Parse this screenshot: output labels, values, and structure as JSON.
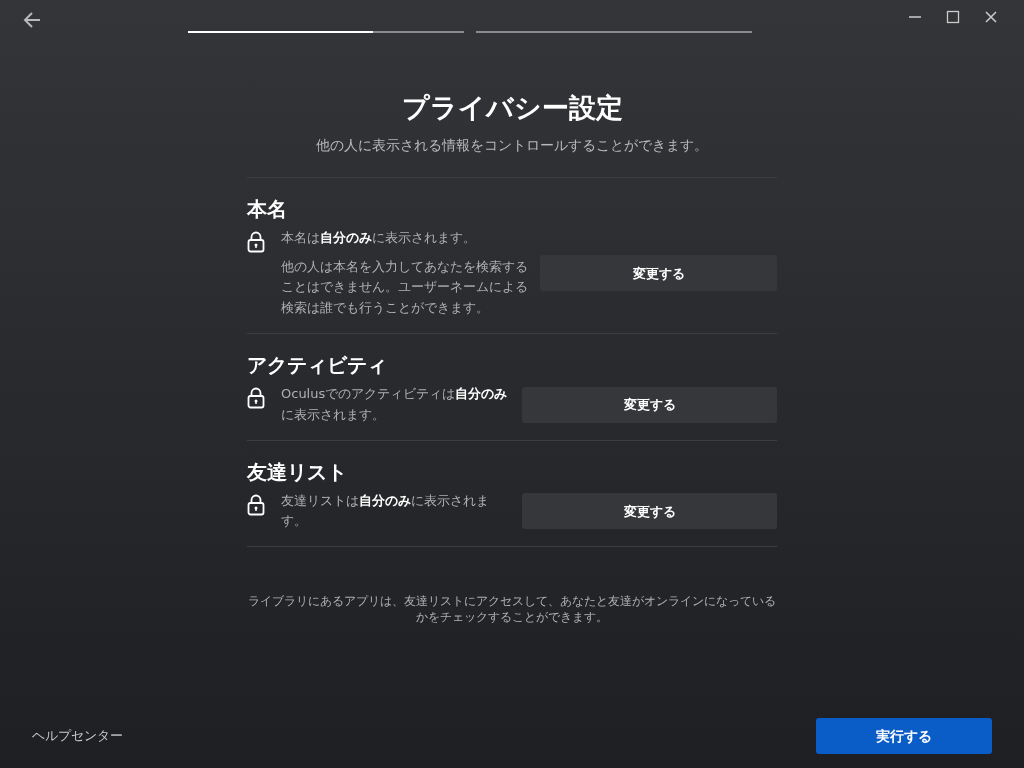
{
  "progress": [
    {
      "level": 0.67
    },
    {
      "level": 0
    }
  ],
  "title": "プライバシー設定",
  "subtitle": "他の人に表示される情報をコントロールすることができます。",
  "sections": [
    {
      "heading": "本名",
      "visibility": "本名は**自分のみ**に表示されます。",
      "note": "他の人は本名を入力してあなたを検索することはできません。ユーザーネームによる検索は誰でも行うことができます。",
      "button": "変更する"
    },
    {
      "heading": "アクティビティ",
      "visibility": "Oculusでのアクティビティは**自分のみ**に表示されます。",
      "button": "変更する"
    },
    {
      "heading": "友達リスト",
      "visibility": "友達リストは**自分のみ**に表示されます。",
      "button": "変更する"
    }
  ],
  "footnote": "ライブラリにあるアプリは、友達リストにアクセスして、あなたと友達がオンラインになっているかをチェックすることができます。",
  "help_link": "ヘルプセンター",
  "primary_button": "実行する"
}
